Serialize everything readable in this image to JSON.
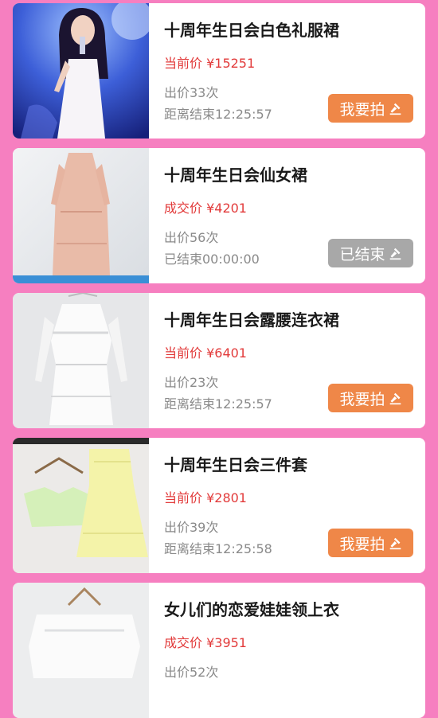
{
  "items": [
    {
      "title": "十周年生日会白色礼服裙",
      "price_label": "当前价 ¥15251",
      "bids": "出价33次",
      "timer": "距离结束12:25:57",
      "button": "我要拍",
      "state": "active",
      "image": "performer-white-dress-photo"
    },
    {
      "title": "十周年生日会仙女裙",
      "price_label": "成交价 ¥4201",
      "bids": "出价56次",
      "timer": "已结束00:00:00",
      "button": "已结束",
      "state": "ended",
      "image": "pink-lace-dress-photo"
    },
    {
      "title": "十周年生日会露腰连衣裙",
      "price_label": "当前价 ¥6401",
      "bids": "出价23次",
      "timer": "距离结束12:25:57",
      "button": "我要拍",
      "state": "active",
      "image": "white-ruffle-dress-photo"
    },
    {
      "title": "十周年生日会三件套",
      "price_label": "当前价 ¥2801",
      "bids": "出价39次",
      "timer": "距离结束12:25:58",
      "button": "我要拍",
      "state": "active",
      "image": "yellow-three-piece-set-photo"
    },
    {
      "title": "女儿们的恋爱娃娃领上衣",
      "price_label": "成交价 ¥3951",
      "bids": "出价52次",
      "timer": "",
      "button": "",
      "state": "partial",
      "image": "white-ruffle-blouse-photo"
    }
  ],
  "colors": {
    "background": "#f67fc0",
    "price": "#e23a3a",
    "active_button": "#ef8748",
    "ended_button": "#a8a8a8"
  }
}
